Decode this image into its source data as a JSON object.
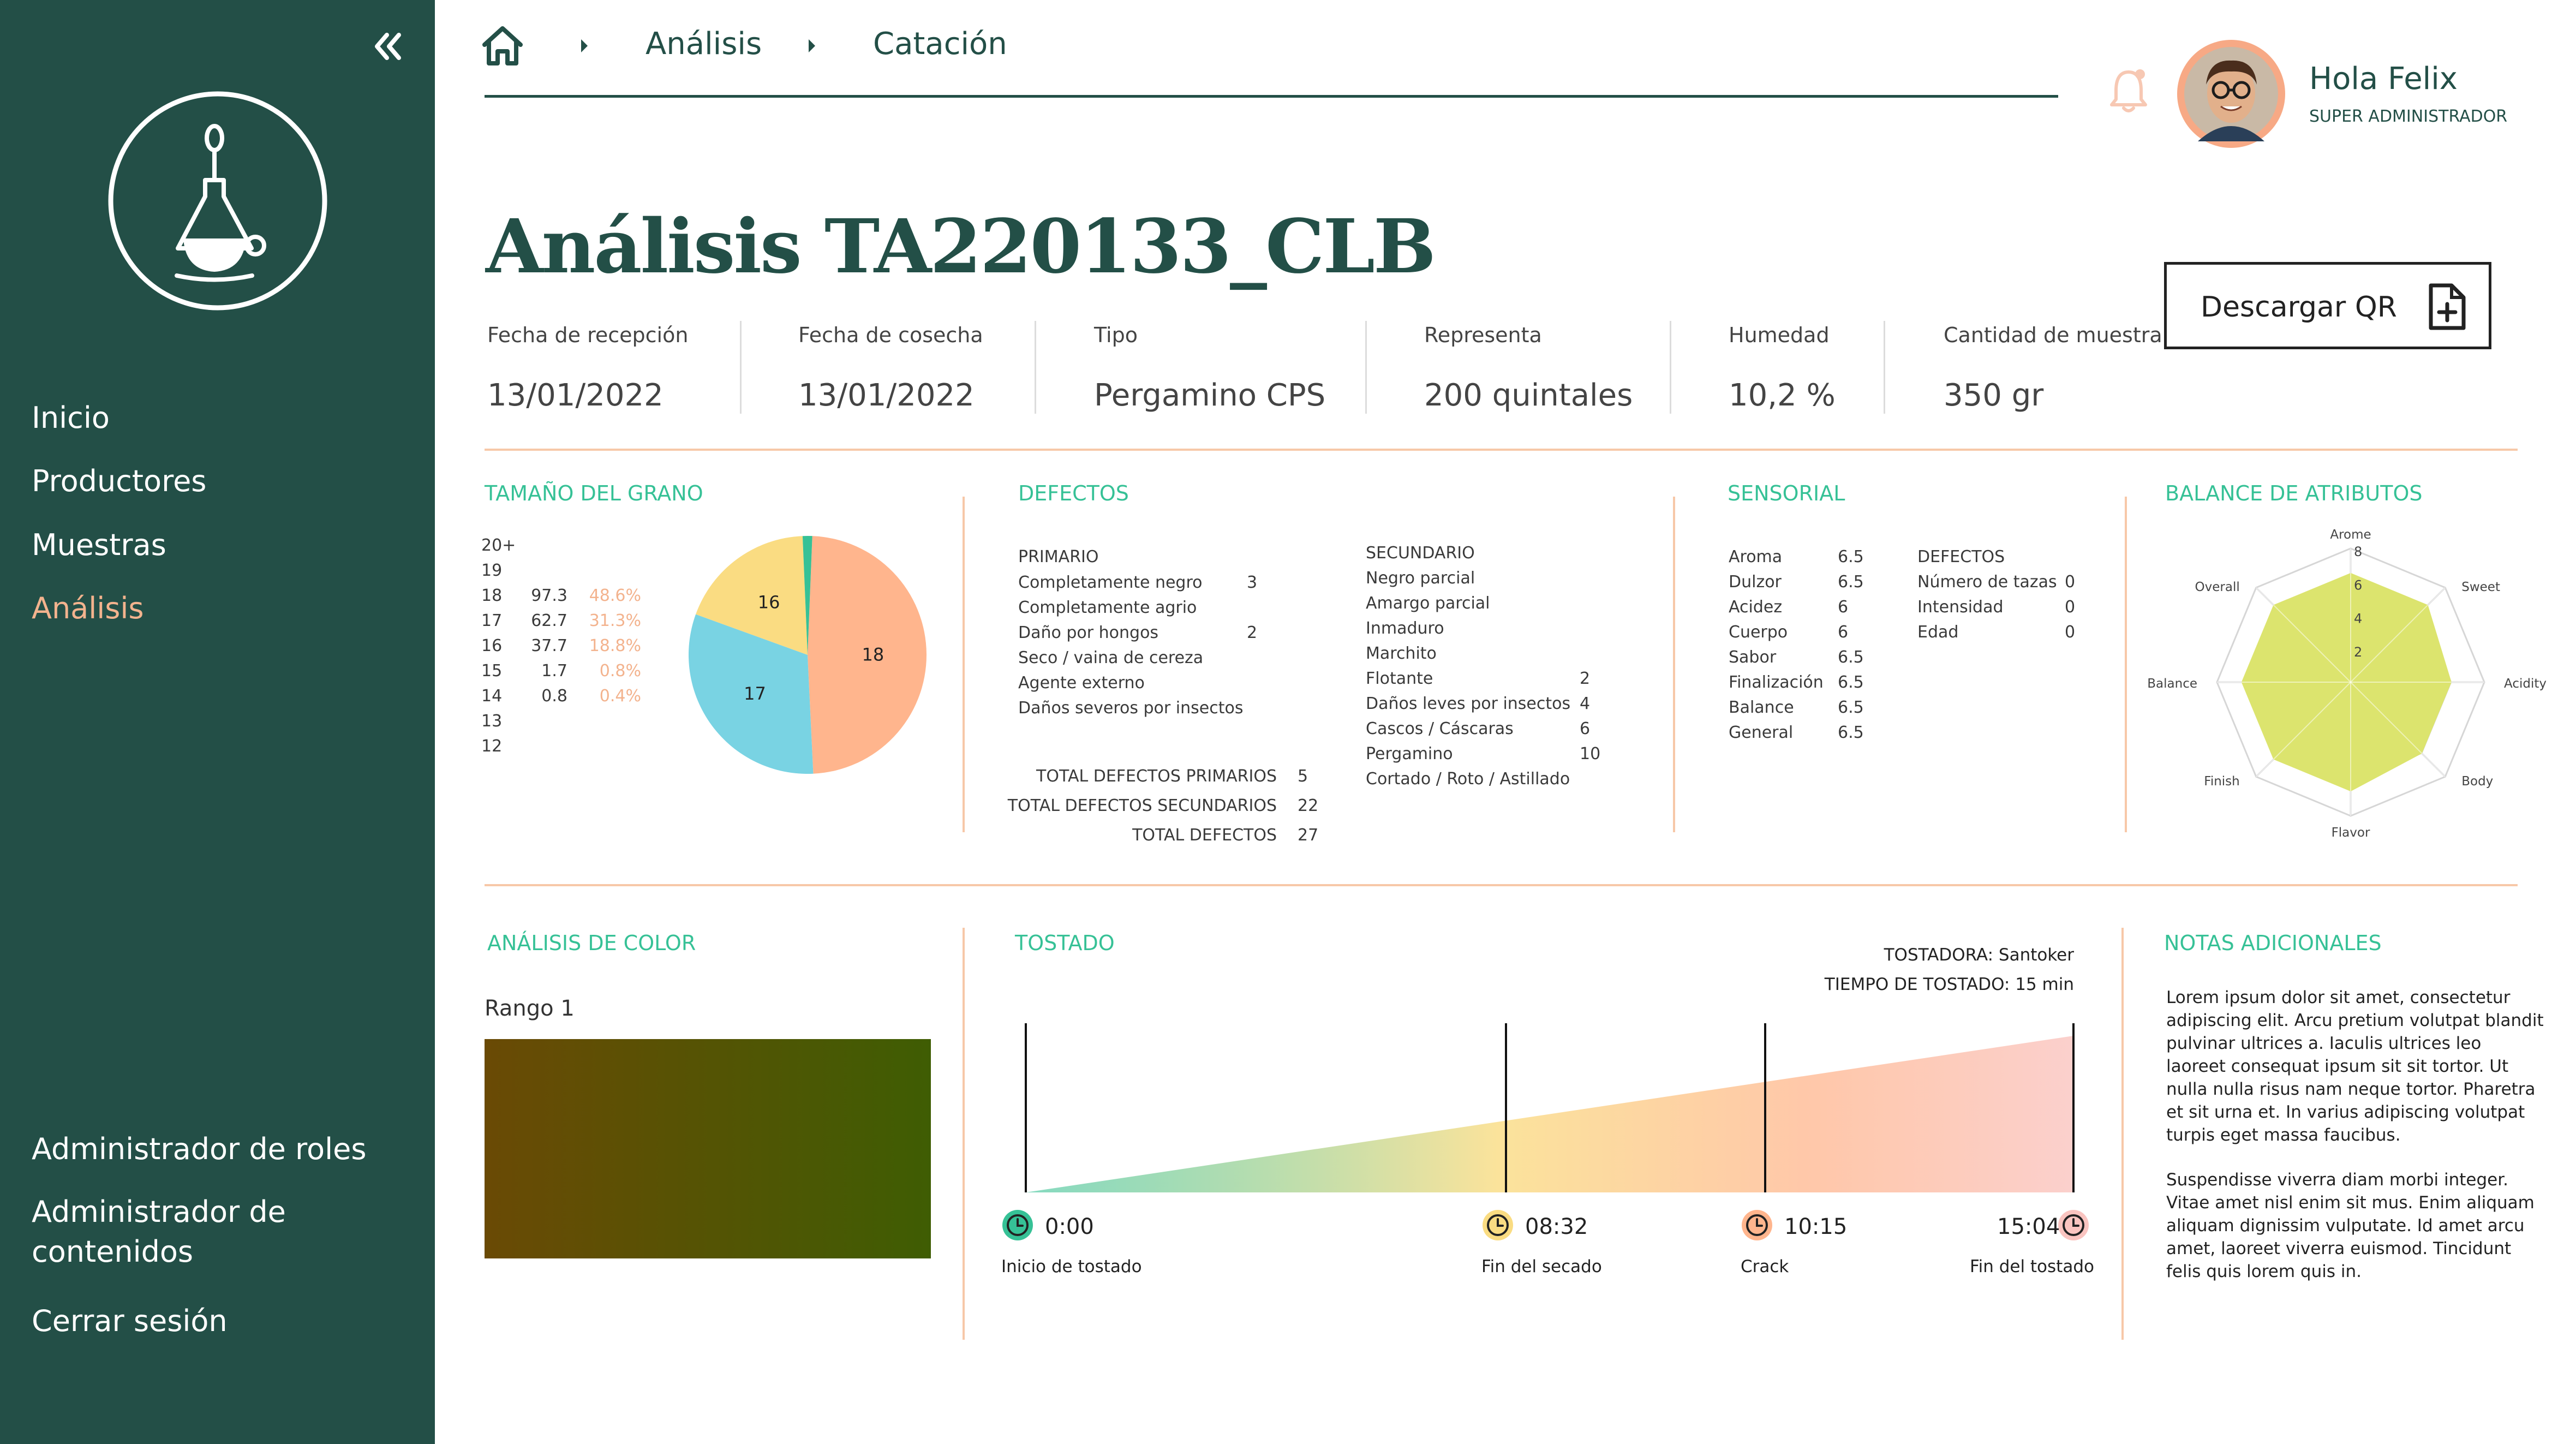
{
  "sidebar": {
    "nav": [
      "Inicio",
      "Productores",
      "Muestras",
      "Análisis"
    ],
    "active": "Análisis",
    "bottom_nav": [
      "Administrador de roles",
      "Administrador de",
      "contenidos",
      "Cerrar sesión"
    ]
  },
  "breadcrumb": [
    "Análisis",
    "Catación"
  ],
  "user": {
    "greeting": "Hola Felix",
    "role": "SUPER ADMINISTRADOR"
  },
  "page": {
    "title": "Análisis TA220133_CLB",
    "qr_button": "Descargar QR"
  },
  "info": [
    {
      "label": "Fecha de recepción",
      "value": "13/01/2022"
    },
    {
      "label": "Fecha de cosecha",
      "value": "13/01/2022"
    },
    {
      "label": "Tipo",
      "value": "Pergamino CPS"
    },
    {
      "label": "Representa",
      "value": "200 quintales"
    },
    {
      "label": "Humedad",
      "value": "10,2 %"
    },
    {
      "label": "Cantidad de muestra",
      "value": "350 gr"
    }
  ],
  "grain": {
    "title": "TAMAÑO  DEL GRANO",
    "rows": [
      {
        "size": "20+",
        "value": "",
        "pct": ""
      },
      {
        "size": "19",
        "value": "",
        "pct": ""
      },
      {
        "size": "18",
        "value": "97.3",
        "pct": "48.6%"
      },
      {
        "size": "17",
        "value": "62.7",
        "pct": "31.3%"
      },
      {
        "size": "16",
        "value": "37.7",
        "pct": "18.8%"
      },
      {
        "size": "15",
        "value": "1.7",
        "pct": "0.8%"
      },
      {
        "size": "14",
        "value": "0.8",
        "pct": "0.4%"
      },
      {
        "size": "13",
        "value": "",
        "pct": ""
      },
      {
        "size": "12",
        "value": "",
        "pct": ""
      }
    ]
  },
  "chart_data": {
    "type": "pie",
    "categories": [
      "18",
      "17",
      "16",
      "15"
    ],
    "values": [
      48.6,
      31.3,
      18.8,
      1.3
    ],
    "labels": [
      "18",
      "17",
      "16"
    ],
    "colors": [
      "#ffb58d",
      "#79d3e3",
      "#fadc82",
      "#36c196"
    ]
  },
  "defects": {
    "title": "DEFECTOS",
    "primary_title": "PRIMARIO",
    "primary": [
      {
        "name": "Completamente negro",
        "value": "3"
      },
      {
        "name": "Completamente agrio",
        "value": ""
      },
      {
        "name": "Daño por hongos",
        "value": "2"
      },
      {
        "name": "Seco / vaina de cereza",
        "value": ""
      },
      {
        "name": "Agente externo",
        "value": ""
      },
      {
        "name": "Daños severos por insectos",
        "value": ""
      }
    ],
    "secondary_title": "SECUNDARIO",
    "secondary": [
      {
        "name": "Negro parcial",
        "value": ""
      },
      {
        "name": "Amargo parcial",
        "value": ""
      },
      {
        "name": "Inmaduro",
        "value": ""
      },
      {
        "name": "Marchito",
        "value": ""
      },
      {
        "name": "Flotante",
        "value": "2"
      },
      {
        "name": "Daños leves por insectos",
        "value": "4"
      },
      {
        "name": "Cascos / Cáscaras",
        "value": "6"
      },
      {
        "name": "Pergamino",
        "value": "10"
      },
      {
        "name": "Cortado /  Roto / Astillado",
        "value": ""
      }
    ],
    "totals": [
      {
        "name": "TOTAL  DEFECTOS  PRIMARIOS",
        "value": "5"
      },
      {
        "name": "TOTAL  DEFECTOS  SECUNDARIOS",
        "value": "22"
      },
      {
        "name": "TOTAL  DEFECTOS",
        "value": "27"
      }
    ]
  },
  "sensorial": {
    "title": "SENSORIAL",
    "items": [
      {
        "name": "Aroma",
        "value": "6.5"
      },
      {
        "name": "Dulzor",
        "value": "6.5"
      },
      {
        "name": "Acidez",
        "value": "6"
      },
      {
        "name": "Cuerpo",
        "value": "6"
      },
      {
        "name": "Sabor",
        "value": "6.5"
      },
      {
        "name": "Finalización",
        "value": "6.5"
      },
      {
        "name": "Balance",
        "value": "6.5"
      },
      {
        "name": "General",
        "value": "6.5"
      }
    ],
    "defects_title": "DEFECTOS",
    "defects": [
      {
        "name": "Número de tazas",
        "value": "0"
      },
      {
        "name": "Intensidad",
        "value": "0"
      },
      {
        "name": "Edad",
        "value": "0"
      }
    ]
  },
  "radar": {
    "title": "BALANCE  DE ATRIBUTOS",
    "axes": [
      "Arome",
      "Sweet",
      "Acidity",
      "Body",
      "Flavor",
      "Finish",
      "Balance",
      "Overall"
    ],
    "values": [
      6.5,
      6.5,
      6,
      6,
      6.5,
      6.5,
      6.5,
      6.5
    ],
    "max": 8,
    "ticks": [
      "2",
      "4",
      "6",
      "8"
    ],
    "fill": "#dce46e"
  },
  "color_analysis": {
    "title": "ANÁLISIS  DE COLOR",
    "range_label": "Rango 1",
    "gradient_from": "#6a4a05",
    "gradient_to": "#3f5d03"
  },
  "roast": {
    "title": "TOSTADO",
    "roaster": "TOSTADORA:  Santoker",
    "time": "TIEMPO  DE TOSTADO: 15 min",
    "markers": [
      {
        "time": "0:00",
        "label": "Inicio de tostado",
        "color": "#36c196"
      },
      {
        "time": "08:32",
        "label": "Fin del secado",
        "color": "#fadc82"
      },
      {
        "time": "10:15",
        "label": "Crack",
        "color": "#ffb58d"
      },
      {
        "time": "15:04",
        "label": "Fin del tostado",
        "color": "#fac4c0"
      }
    ]
  },
  "notes": {
    "title": "NOTAS ADICIONALES",
    "p1": [
      "Lorem ipsum dolor sit amet, consectetur",
      "adipiscing elit. Arcu pretium volutpat blandit",
      "pulvinar ultrices a.  Iaculis ultrices leo",
      "laoreet consequat ipsum sit sit tortor. Ut",
      "nulla nulla risus nam neque tortor.  Pharetra",
      "et sit urna et.  In varius adipiscing volutpat",
      "turpis eget massa faucibus."
    ],
    "p2": [
      "Suspendisse viverra diam morbi integer.",
      "Vitae amet nisl enim sit mus.  Enim aliquam",
      "aliquam dignissim vulputate.  Id amet arcu",
      "amet, laoreet viverra euismod. Tincidunt",
      "felis quis lorem quis in."
    ]
  }
}
